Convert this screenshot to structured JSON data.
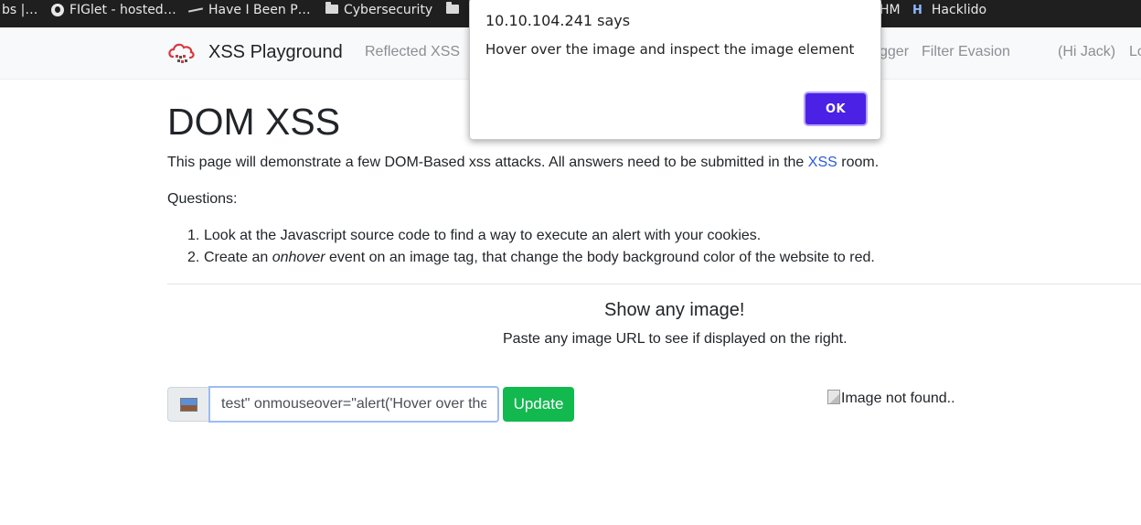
{
  "bookmarks": [
    {
      "label": "bs |…",
      "icon": "none"
    },
    {
      "label": "FIGlet - hosted…",
      "icon": "globe-icon"
    },
    {
      "label": "Have I Been P…",
      "icon": "hibp-icon"
    },
    {
      "label": "Cybersecurity",
      "icon": "folder-icon"
    },
    {
      "label": "HM",
      "icon": "none"
    },
    {
      "label": "Hacklido",
      "icon": "hacklido-icon",
      "icon_text": "H"
    }
  ],
  "navbar": {
    "brand": "XSS Playground",
    "links": [
      "Reflected XSS",
      "gger",
      "Filter Evasion"
    ],
    "user": "(Hi Jack)",
    "cut_link": "Lo"
  },
  "main": {
    "title": "DOM XSS",
    "intro_before": "This page will demonstrate a few DOM-Based xss attacks. All answers need to be submitted in the ",
    "intro_link": "XSS",
    "intro_after": " room.",
    "questions_label": "Questions:",
    "questions": [
      {
        "num": "1.",
        "text": "Look at the Javascript source code to find a way to execute an alert with your cookies."
      },
      {
        "num": "2.",
        "text_before": "Create an ",
        "text_em": "onhover",
        "text_after": " event on an image tag, that change the body background color of the website to red."
      }
    ],
    "show_title": "Show any image!",
    "show_sub": "Paste any image URL to see if displayed on the right.",
    "url_value": "test\" onmouseover=\"alert('Hover over the image and inspect the image element')\"",
    "update_label": "Update",
    "broken_image_alt": "Image not found.."
  },
  "dialog": {
    "title": "10.10.104.241 says",
    "message": "Hover over the image and inspect the image element",
    "ok_label": "OK"
  },
  "colors": {
    "bookmarks_bg": "#1f1f1f",
    "navbar_bg": "#f8f9fa",
    "link": "#2a5bd7",
    "update_button": "#12b94f",
    "ok_button": "#4a21e5"
  }
}
